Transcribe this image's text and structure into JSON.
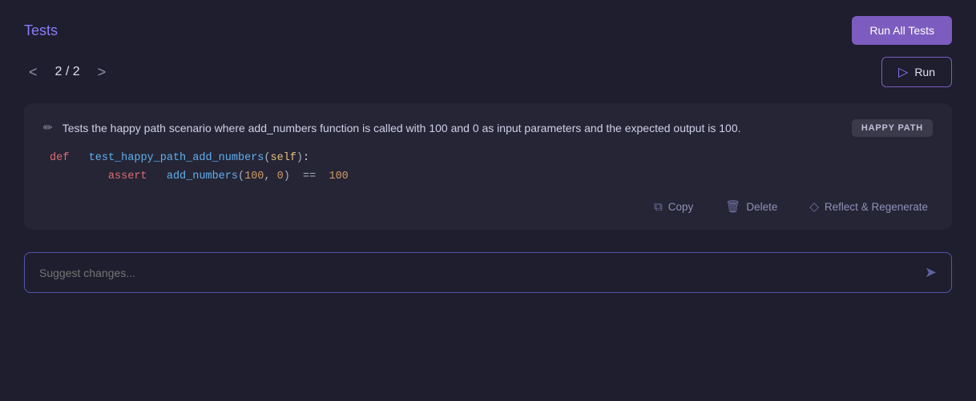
{
  "header": {
    "title": "Tests",
    "run_all_label": "Run All Tests"
  },
  "pagination": {
    "current": "2",
    "total": "2",
    "display": "2 / 2",
    "prev_label": "<",
    "next_label": ">"
  },
  "run_button": {
    "label": "Run"
  },
  "test": {
    "description": "Tests the happy path scenario where add_numbers function is called with 100 and 0 as input parameters and the expected output is 100.",
    "badge": "HAPPY PATH",
    "code": {
      "line1": "def test_happy_path_add_numbers(self):",
      "line2_indent": "    ",
      "line2": "assert add_numbers(100, 0) == 100"
    }
  },
  "actions": {
    "copy_label": "Copy",
    "delete_label": "Delete",
    "reflect_label": "Reflect & Regenerate"
  },
  "suggest": {
    "placeholder": "Suggest changes..."
  },
  "icons": {
    "run_icon": "▷",
    "edit_icon": "✏",
    "copy_icon": "⧉",
    "delete_icon": "🗑",
    "reflect_icon": "◇",
    "send_icon": "➤"
  },
  "colors": {
    "accent": "#7c5cbf",
    "title": "#8b7cf8"
  }
}
